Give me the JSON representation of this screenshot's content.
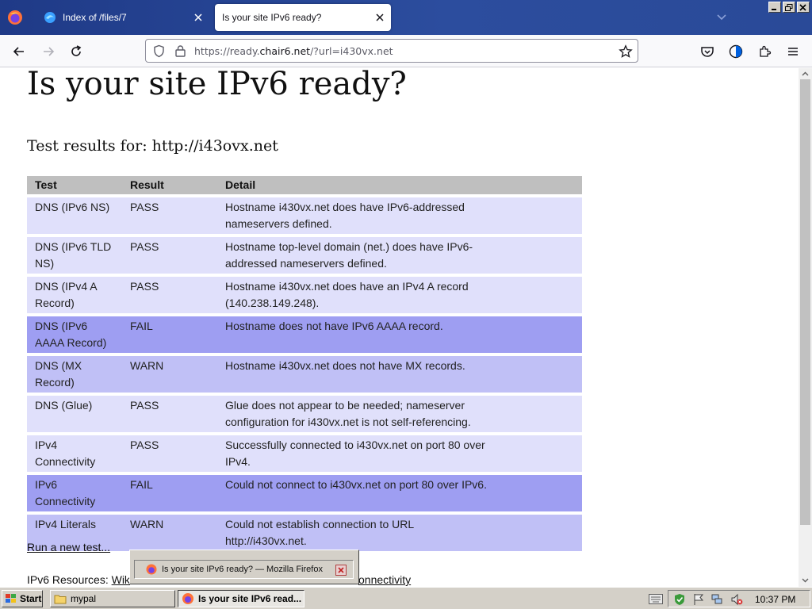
{
  "browser": {
    "tabs": [
      {
        "title": "Index of /files/7",
        "active": false
      },
      {
        "title": "Is your site IPv6 ready?",
        "active": true
      }
    ],
    "url": {
      "prefix": "https://ready.",
      "host": "chair6.net",
      "suffix": "/?url=i430vx.net"
    }
  },
  "page": {
    "title": "Is your site IPv6 ready?",
    "test_for_label": "Test results for: http://i43ovx.net",
    "table": {
      "headers": [
        "Test",
        "Result",
        "Detail"
      ],
      "rows": [
        {
          "test": "DNS (IPv6 NS)",
          "result": "PASS",
          "detail": "Hostname i430vx.net does have IPv6-addressed nameservers defined."
        },
        {
          "test": "DNS (IPv6 TLD NS)",
          "result": "PASS",
          "detail": "Hostname top-level domain (net.) does have IPv6-addressed nameservers defined."
        },
        {
          "test": "DNS (IPv4 A Record)",
          "result": "PASS",
          "detail": "Hostname i430vx.net does have an IPv4 A record (140.238.149.248)."
        },
        {
          "test": "DNS (IPv6 AAAA Record)",
          "result": "FAIL",
          "detail": "Hostname does not have IPv6 AAAA record."
        },
        {
          "test": "DNS (MX Record)",
          "result": "WARN",
          "detail": "Hostname i430vx.net does not have MX records."
        },
        {
          "test": "DNS (Glue)",
          "result": "PASS",
          "detail": "Glue does not appear to be needed; nameserver configuration for i430vx.net is not self-referencing."
        },
        {
          "test": "IPv4 Connectivity",
          "result": "PASS",
          "detail": "Successfully connected to i430vx.net on port 80 over IPv4."
        },
        {
          "test": "IPv6 Connectivity",
          "result": "FAIL",
          "detail": "Could not connect to i430vx.net on port 80 over IPv6."
        },
        {
          "test": "IPv4 Literals",
          "result": "WARN",
          "detail": "Could not establish connection to URL http://i430vx.net."
        }
      ]
    },
    "run_new_test": "Run a new test...",
    "resources_label": "IPv6 Resources: ",
    "resources_link1": "Wik",
    "resources_link2": "onnectivity"
  },
  "popup": {
    "title": "Is your site IPv6 ready? — Mozilla Firefox"
  },
  "taskbar": {
    "start": "Start",
    "buttons": [
      {
        "label": "mypal",
        "pressed": false
      },
      {
        "label": "Is your site IPv6 read...",
        "pressed": true
      }
    ],
    "clock": "10:37 PM"
  },
  "colors": {
    "pass_row": "#e0e0fb",
    "warn_row": "#c0c0f6",
    "fail_row": "#9e9ef2",
    "header_row": "#bfbfbf",
    "tabbar": "#2c4d9e"
  },
  "icons": [
    "firefox-icon",
    "edge-icon",
    "close-icon",
    "chevron-down-icon",
    "back-icon",
    "forward-icon",
    "reload-icon",
    "shield-icon",
    "lock-icon",
    "star-icon",
    "pocket-icon",
    "contrast-icon",
    "extensions-icon",
    "menu-icon",
    "folder-icon",
    "keyboard-icon",
    "network-icon",
    "flag-icon",
    "volume-icon"
  ]
}
